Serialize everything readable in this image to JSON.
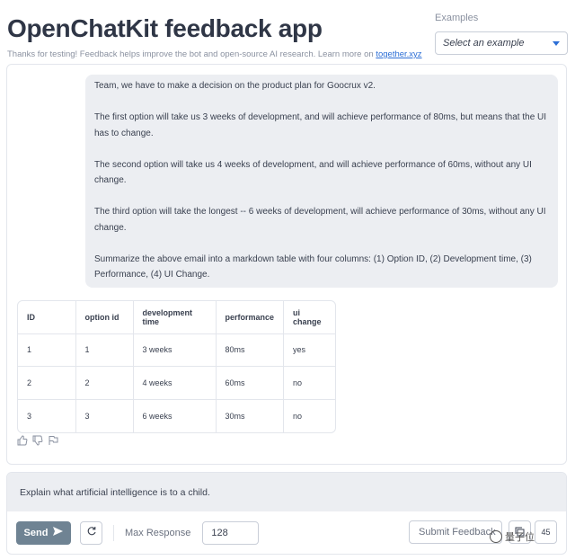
{
  "header": {
    "title": "OpenChatKit feedback app",
    "subtitle": "Thanks for testing! Feedback helps improve the bot and open-source AI research. Learn more on ",
    "link_text": "together.xyz"
  },
  "examples": {
    "label": "Examples",
    "placeholder": "Select an example"
  },
  "chat": {
    "user_message": [
      "Team, we have to make a decision on the product plan for Goocrux v2.",
      "The first option will take us 3 weeks of development, and will achieve performance of 80ms, but means that the UI has to change.",
      "The second option will take us 4 weeks of development, and will achieve performance of 60ms, without any UI change.",
      "The third option will take the longest -- 6 weeks of development, will achieve performance of 30ms, without any UI change.",
      "Summarize the above email into a markdown table with four columns: (1) Option ID, (2) Development time, (3) Performance, (4) UI Change."
    ],
    "table": {
      "headers": [
        "ID",
        "option id",
        "development time",
        "performance",
        "ui change"
      ],
      "rows": [
        [
          "1",
          "1",
          "3 weeks",
          "80ms",
          "yes"
        ],
        [
          "2",
          "2",
          "4 weeks",
          "60ms",
          "no"
        ],
        [
          "3",
          "3",
          "6 weeks",
          "30ms",
          "no"
        ]
      ]
    }
  },
  "input": {
    "prompt_text": "Explain what artificial intelligence is to a child."
  },
  "controls": {
    "send_label": "Send",
    "max_response_label": "Max Response",
    "max_response_value": "128",
    "submit_feedback_label": "Submit Feedback",
    "corner_button_label": "45"
  },
  "watermark": {
    "text": "量子位"
  },
  "colors": {
    "accent": "#2d6fd6",
    "send_button": "#6f8393",
    "bubble_bg": "#eceef2"
  }
}
